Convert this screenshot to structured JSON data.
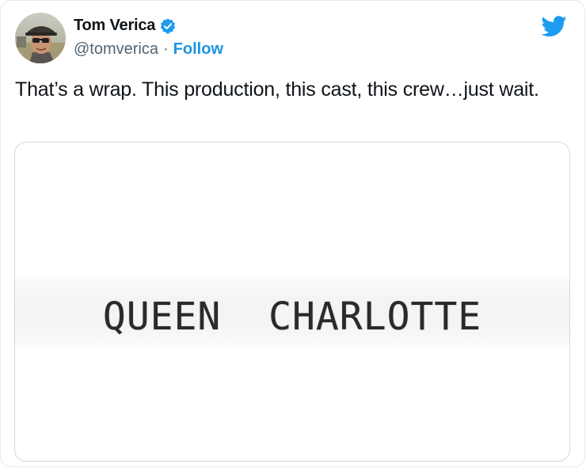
{
  "tweet": {
    "author_name": "Tom Verica",
    "handle": "@tomverica",
    "separator": "·",
    "follow_label": "Follow",
    "text": "That’s a wrap. This production, this cast, this crew…just wait."
  },
  "media": {
    "image_text": "QUEEN  CHARLOTTE"
  },
  "icons": {
    "verified": "verified-badge-icon",
    "logo": "twitter-bird-icon"
  },
  "colors": {
    "twitter_blue": "#1d9bf0",
    "follow_link": "#1b95e0",
    "text_primary": "#0f1419",
    "text_secondary": "#536471"
  }
}
